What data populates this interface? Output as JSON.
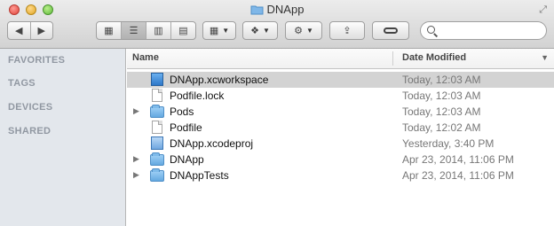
{
  "window": {
    "title": "DNApp"
  },
  "sidebar": {
    "sections": [
      {
        "label": "FAVORITES"
      },
      {
        "label": "TAGS"
      },
      {
        "label": "DEVICES"
      },
      {
        "label": "SHARED"
      }
    ]
  },
  "list": {
    "columns": {
      "name": "Name",
      "date": "Date Modified"
    },
    "rows": [
      {
        "name": "DNApp.xcworkspace",
        "date": "Today, 12:03 AM",
        "kind": "xcworkspace",
        "expandable": false,
        "selected": true
      },
      {
        "name": "Podfile.lock",
        "date": "Today, 12:03 AM",
        "kind": "document",
        "expandable": false,
        "selected": false
      },
      {
        "name": "Pods",
        "date": "Today, 12:03 AM",
        "kind": "folder",
        "expandable": true,
        "selected": false
      },
      {
        "name": "Podfile",
        "date": "Today, 12:02 AM",
        "kind": "document",
        "expandable": false,
        "selected": false
      },
      {
        "name": "DNApp.xcodeproj",
        "date": "Yesterday, 3:40 PM",
        "kind": "xcodeproj",
        "expandable": false,
        "selected": false
      },
      {
        "name": "DNApp",
        "date": "Apr 23, 2014, 11:06 PM",
        "kind": "folder",
        "expandable": true,
        "selected": false
      },
      {
        "name": "DNAppTests",
        "date": "Apr 23, 2014, 11:06 PM",
        "kind": "folder",
        "expandable": true,
        "selected": false
      }
    ]
  },
  "toolbar": {
    "view_mode_selected": "list",
    "icons": [
      "back-arrow-icon",
      "forward-arrow-icon",
      "icon-view-icon",
      "list-view-icon",
      "column-view-icon",
      "coverflow-view-icon",
      "arrange-icon",
      "dropbox-icon",
      "gear-icon",
      "share-icon",
      "tag-icon",
      "search-icon"
    ]
  }
}
